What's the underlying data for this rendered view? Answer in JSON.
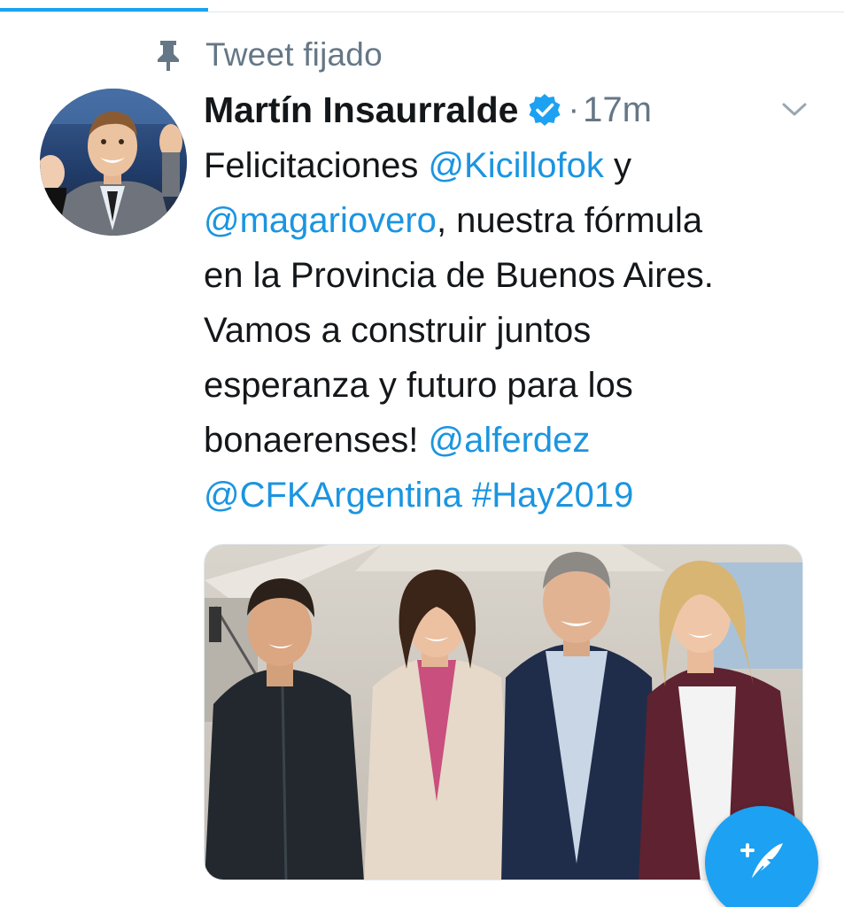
{
  "pinned": {
    "icon": "pin-icon",
    "label": "Tweet fijado"
  },
  "tweet": {
    "author": {
      "name": "Martín Insaurralde",
      "verified_icon": "verified-badge-icon"
    },
    "separator": "·",
    "time": "17m",
    "menu_icon": "chevron-down-icon",
    "text_lines": [
      [
        {
          "t": "Felicitaciones ",
          "link": false
        },
        {
          "t": "@Kicillofok",
          "link": true
        },
        {
          "t": " y",
          "link": false
        }
      ],
      [
        {
          "t": "@magariovero",
          "link": true
        },
        {
          "t": ", nuestra fórmula",
          "link": false
        }
      ],
      [
        {
          "t": "en la Provincia de Buenos Aires.",
          "link": false
        }
      ],
      [
        {
          "t": "Vamos a construir juntos",
          "link": false
        }
      ],
      [
        {
          "t": "esperanza y futuro para los",
          "link": false
        }
      ],
      [
        {
          "t": "bonaerenses! ",
          "link": false
        },
        {
          "t": "@alferdez",
          "link": true
        }
      ],
      [
        {
          "t": "@CFKArgentina",
          "link": true
        },
        {
          "t": " ",
          "link": false
        },
        {
          "t": "#Hay2019",
          "link": true
        }
      ]
    ]
  },
  "compose_fab": {
    "icon": "compose-tweet-icon"
  },
  "colors": {
    "accent": "#1da1f2",
    "link": "#1b95e0",
    "secondary_text": "#657786",
    "primary_text": "#14171a"
  }
}
